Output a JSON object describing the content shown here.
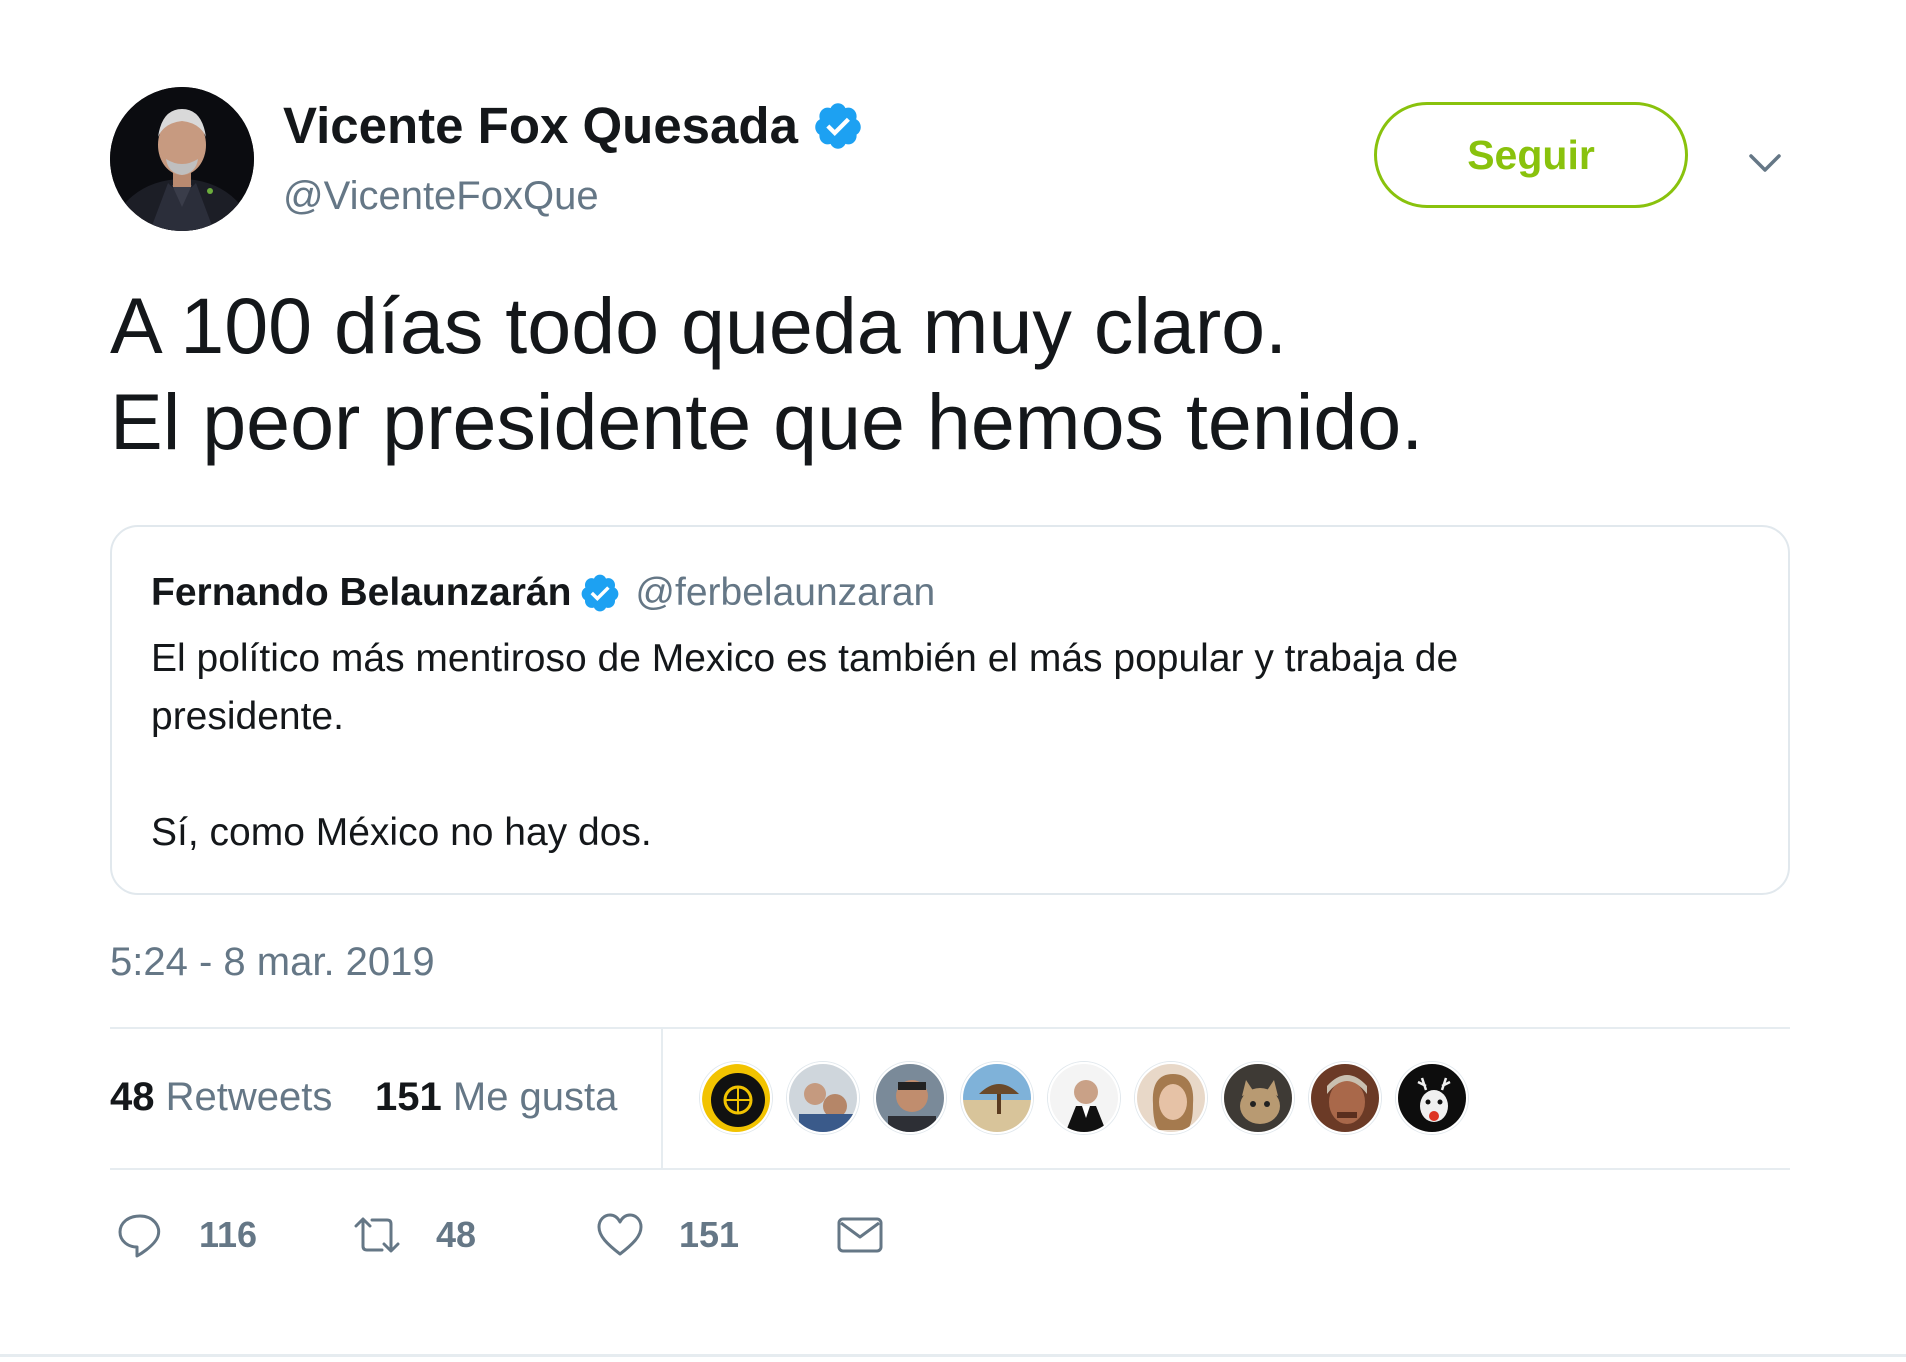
{
  "header": {
    "display_name": "Vicente Fox Quesada",
    "handle": "@VicenteFoxQue",
    "follow_label": "Seguir",
    "verified_icon": "verified-badge-icon",
    "colors": {
      "follow_accent": "#89c20d",
      "verified": "#1da1f2",
      "secondary_text": "#657786"
    }
  },
  "tweet": {
    "lines": [
      "A 100 días todo queda muy claro.",
      "El peor presidente que hemos tenido."
    ],
    "timestamp": "5:24 - 8 mar. 2019"
  },
  "quoted": {
    "display_name": "Fernando Belaunzarán",
    "handle": "@ferbelaunzaran",
    "lines": [
      "El político más mentiroso de Mexico es también el más popular y trabaja de",
      "presidente.",
      "Sí, como México no hay dos."
    ]
  },
  "stats": {
    "retweets_count": "48",
    "retweets_label": "Retweets",
    "likes_count": "151",
    "likes_label": "Me gusta",
    "liker_avatar_count": 9
  },
  "actions": {
    "reply_count": "116",
    "retweet_count": "48",
    "like_count": "151"
  }
}
